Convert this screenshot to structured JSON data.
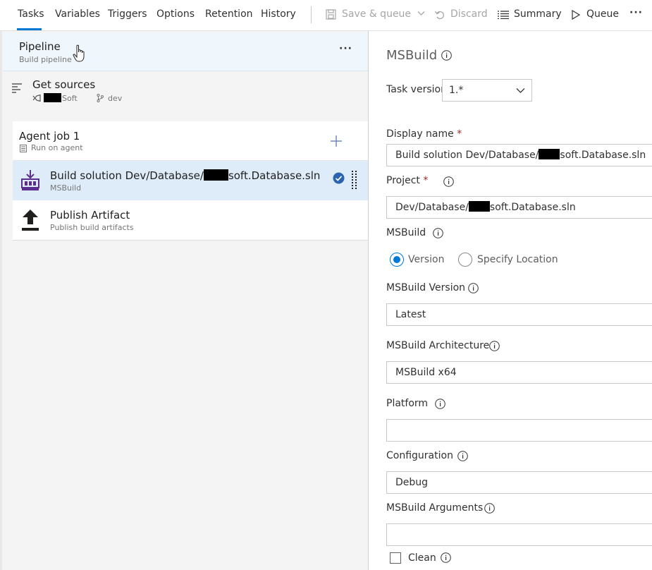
{
  "tabs": [
    {
      "label": "Tasks"
    },
    {
      "label": "Variables"
    },
    {
      "label": "Triggers"
    },
    {
      "label": "Options"
    },
    {
      "label": "Retention"
    },
    {
      "label": "History"
    }
  ],
  "toolbar": {
    "save_queue": "Save & queue",
    "discard": "Discard",
    "summary": "Summary",
    "queue": "Queue",
    "more": "···"
  },
  "pipeline": {
    "title": "Pipeline",
    "subtitle": "Build pipeline",
    "more": "···"
  },
  "get_sources": {
    "title": "Get sources",
    "repo_suffix": "Soft",
    "branch": "dev"
  },
  "agent_job": {
    "title": "Agent job 1",
    "subtitle": "Run on agent"
  },
  "tasks": [
    {
      "title_prefix": "Build solution Dev/Database/",
      "title_suffix": "soft.Database.sln",
      "subtitle": "MSBuild"
    },
    {
      "title": "Publish Artifact",
      "subtitle": "Publish build artifacts"
    }
  ],
  "details": {
    "heading": "MSBuild",
    "task_version_label": "Task version",
    "task_version_value": "1.*",
    "display_name_label": "Display name",
    "display_name_prefix": "Build solution Dev/Database/",
    "display_name_suffix": "soft.Database.sln",
    "project_label": "Project",
    "project_prefix": "Dev/Database/",
    "project_suffix": "soft.Database.sln",
    "msbuild_label": "MSBuild",
    "radio_version": "Version",
    "radio_location": "Specify Location",
    "msbuild_version_label": "MSBuild Version",
    "msbuild_version_value": "Latest",
    "msbuild_arch_label": "MSBuild Architecture",
    "msbuild_arch_value": "MSBuild x64",
    "platform_label": "Platform",
    "platform_value": "",
    "configuration_label": "Configuration",
    "configuration_value": "Debug",
    "msbuild_args_label": "MSBuild Arguments",
    "msbuild_args_value": "",
    "clean_label": "Clean",
    "required_mark": "*"
  },
  "colors": {
    "accent": "#0078d4",
    "selected_row": "#deecf9",
    "required": "#a4262c"
  }
}
